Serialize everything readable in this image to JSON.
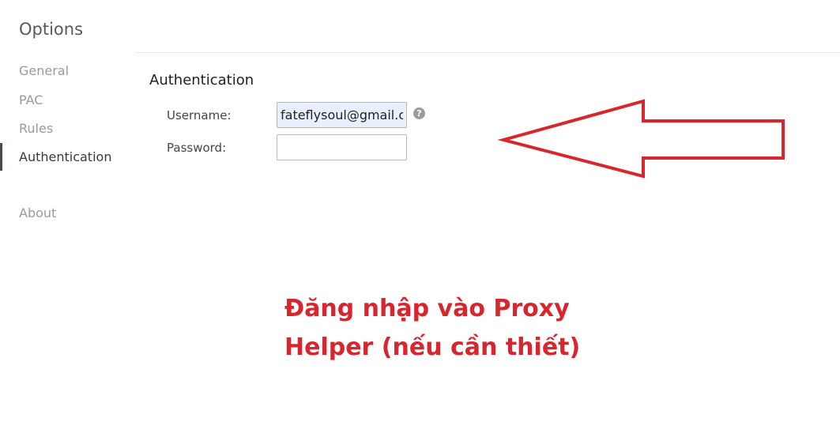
{
  "sidebar": {
    "title": "Options",
    "items": [
      {
        "label": "General",
        "active": false
      },
      {
        "label": "PAC",
        "active": false
      },
      {
        "label": "Rules",
        "active": false
      },
      {
        "label": "Authentication",
        "active": true
      },
      {
        "label": "About",
        "active": false
      }
    ]
  },
  "main": {
    "section_title": "Authentication",
    "fields": {
      "username": {
        "label": "Username:",
        "value": "fateflysoul@gmail.com",
        "placeholder": ""
      },
      "password": {
        "label": "Password:",
        "value": "",
        "placeholder": ""
      }
    },
    "help_icon": {
      "name": "help-icon",
      "glyph": "?"
    }
  },
  "annotation": {
    "arrow_icon": "left-arrow-outline",
    "arrow_color": "#d8262e",
    "line1": "Đăng nhập vào Proxy",
    "line2": "Helper (nếu cần thiết)",
    "color": "#d8262e"
  }
}
